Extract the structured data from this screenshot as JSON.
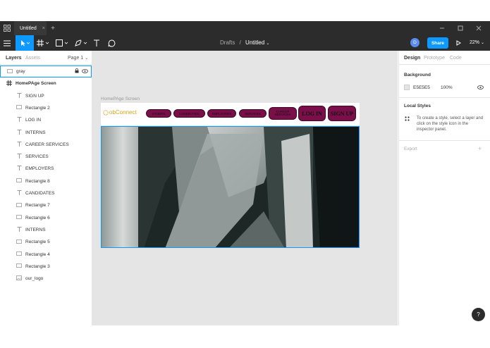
{
  "tabbar": {
    "file_tab": "Untitled",
    "close": "×",
    "add": "+"
  },
  "toolbar": {
    "breadcrumb_parent": "Drafts",
    "breadcrumb_sep": "/",
    "file_name": "Untitled",
    "avatar_letter": "D",
    "share_label": "Share",
    "zoom": "22%"
  },
  "left_panel": {
    "tab_layers": "Layers",
    "tab_assets": "Assets",
    "page": "Page 1",
    "layers": [
      {
        "name": "gray",
        "icon": "rectangle-icon"
      },
      {
        "name": "HomePAge Screen",
        "icon": "frame-icon"
      },
      {
        "name": "SIGN UP",
        "icon": "text-icon"
      },
      {
        "name": "Rectangle 2",
        "icon": "rectangle-icon"
      },
      {
        "name": "LOG IN",
        "icon": "text-icon"
      },
      {
        "name": "INTERNS",
        "icon": "text-icon"
      },
      {
        "name": "CAREER SERVICES",
        "icon": "text-icon"
      },
      {
        "name": "SERVICES",
        "icon": "text-icon"
      },
      {
        "name": "EMPLOYERS",
        "icon": "text-icon"
      },
      {
        "name": "Rectangle 8",
        "icon": "rectangle-icon"
      },
      {
        "name": "CANDIDATES",
        "icon": "text-icon"
      },
      {
        "name": "Rectangle 7",
        "icon": "rectangle-icon"
      },
      {
        "name": "Rectangle 6",
        "icon": "rectangle-icon"
      },
      {
        "name": "INTERNS",
        "icon": "text-icon"
      },
      {
        "name": "Rectangle 5",
        "icon": "rectangle-icon"
      },
      {
        "name": "Rectangle 4",
        "icon": "rectangle-icon"
      },
      {
        "name": "Rectangle 3",
        "icon": "rectangle-icon"
      },
      {
        "name": "our_logo",
        "icon": "image-icon"
      }
    ]
  },
  "canvas": {
    "frame_label": "HomePAge Screen",
    "logo_text": "obConnect",
    "nav_buttons": [
      "OTHERS",
      "CANDIDATES",
      "EMPLOYERS",
      "SERVICES",
      "CAREER SERVICES"
    ],
    "login": "LOG IN",
    "signup": "SIGN UP"
  },
  "right_panel": {
    "tab_design": "Design",
    "tab_prototype": "Prototype",
    "tab_code": "Code",
    "background_title": "Background",
    "bg_hex": "E5E5E5",
    "bg_opacity": "100%",
    "local_styles_title": "Local Styles",
    "local_styles_help": "To create a style, select a layer and click on the style icon in the inspector panel.",
    "export_title": "Export"
  },
  "help_button": "?",
  "colors": {
    "accent": "#0d99ff",
    "nav_button": "#7a0f4a",
    "canvas_bg": "#e5e5e5",
    "toolbar_bg": "#2c2c2c"
  }
}
